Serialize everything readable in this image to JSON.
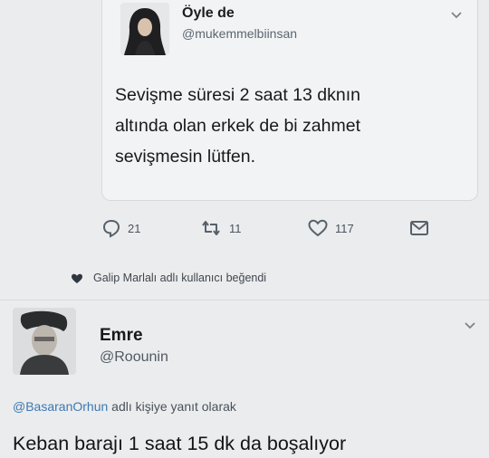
{
  "quoted_tweet": {
    "display_name": "Öyle de",
    "handle": "@mukemmelbiinsan",
    "text_lines": [
      "Sevişme süresi 2 saat 13 dknın",
      "altında olan erkek de bi zahmet",
      "sevişmesin lütfen."
    ]
  },
  "actions": {
    "reply_count": "21",
    "retweet_count": "11",
    "like_count": "117"
  },
  "like_notice": "Galip Marlalı adlı kullanıcı beğendi",
  "reply_tweet": {
    "display_name": "Emre",
    "handle": "@Roounin",
    "reply_context_mention": "@BasaranOrhun",
    "reply_context_suffix": " adlı kişiye yanıt olarak",
    "text": "Keban barajı 1 saat 15 dk da boşalıyor"
  },
  "colors": {
    "background": "#ebeced",
    "mention": "#3b78b4",
    "icon": "#56616b"
  },
  "icons": [
    "reply-icon",
    "retweet-icon",
    "like-icon",
    "message-icon",
    "heart-icon",
    "chevron-down-icon"
  ]
}
